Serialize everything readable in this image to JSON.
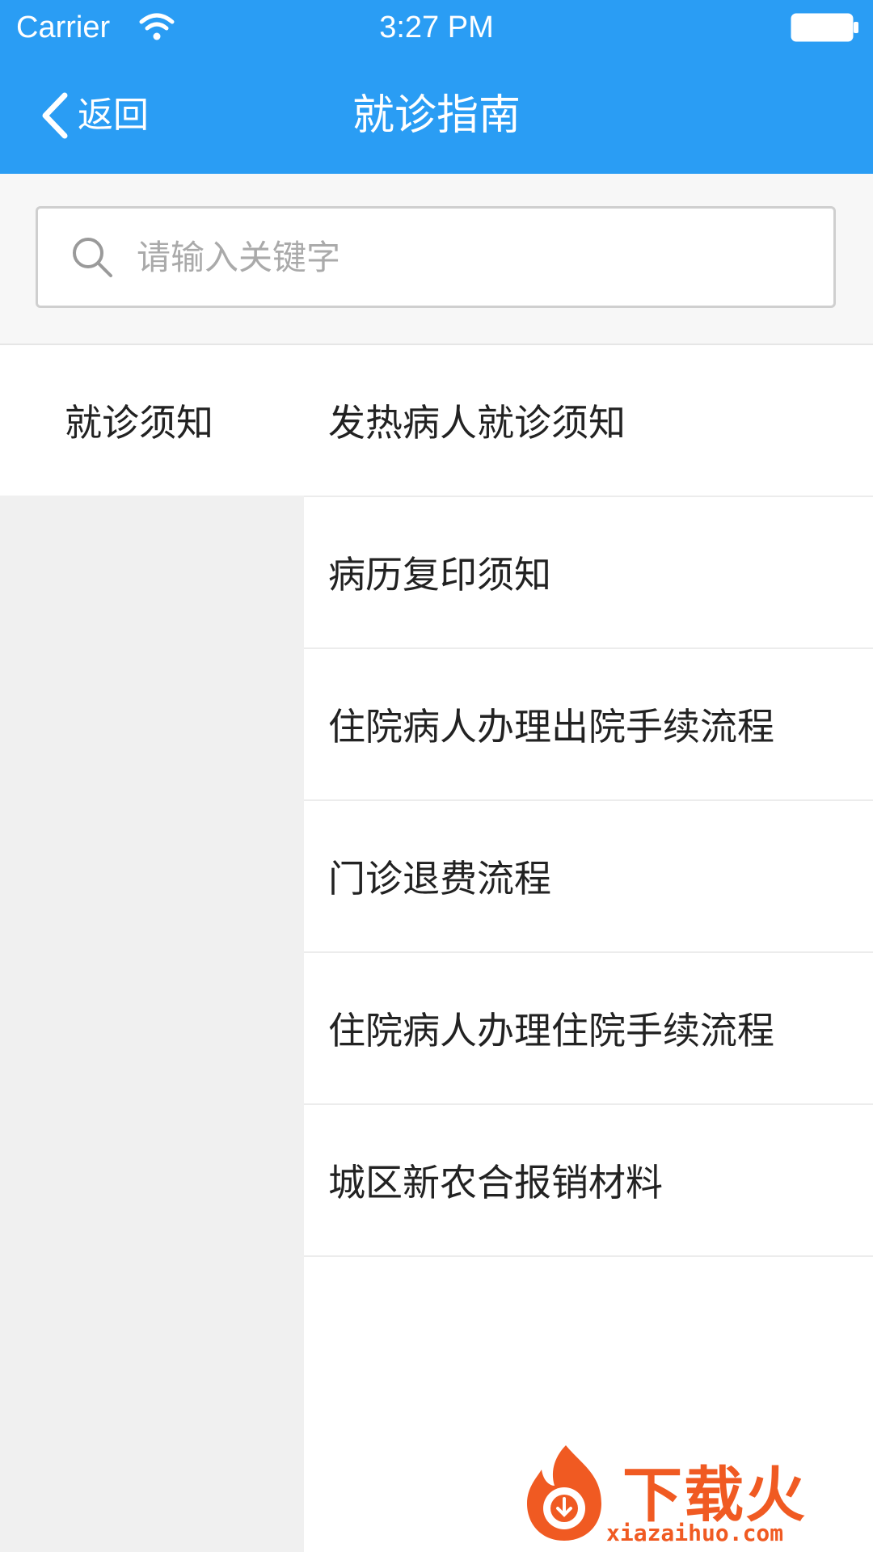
{
  "status_bar": {
    "carrier": "Carrier",
    "time": "3:27 PM"
  },
  "nav": {
    "back_label": "返回",
    "title": "就诊指南"
  },
  "search": {
    "placeholder": "请输入关键字",
    "value": ""
  },
  "categories": [
    {
      "label": "就诊须知",
      "selected": true
    }
  ],
  "articles": [
    {
      "label": "发热病人就诊须知"
    },
    {
      "label": "病历复印须知"
    },
    {
      "label": "住院病人办理出院手续流程"
    },
    {
      "label": "门诊退费流程"
    },
    {
      "label": "住院病人办理住院手续流程"
    },
    {
      "label": "城区新农合报销材料"
    }
  ],
  "watermark": {
    "brand": "下载火",
    "url": "xiazaihuo.com"
  },
  "colors": {
    "accent": "#2a9df4",
    "watermark": "#f05a22",
    "sidebar_bg": "#f0f0f0"
  }
}
